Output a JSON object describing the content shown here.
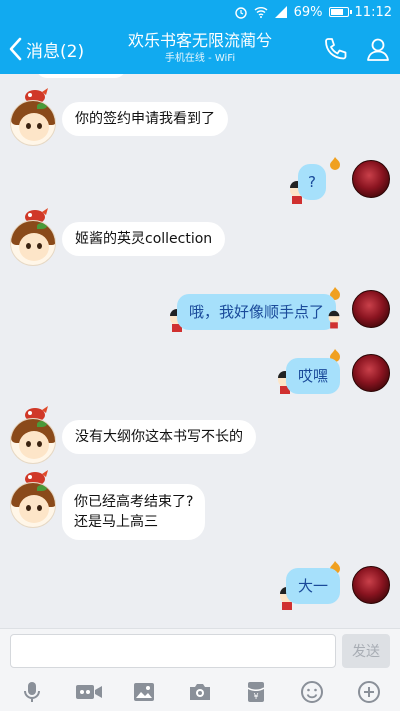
{
  "status_bar": {
    "battery": "69%",
    "time": "11:12",
    "battery_level": 0.69
  },
  "header": {
    "back_label": "消息(2)",
    "title": "欢乐书客无限流蔺兮",
    "subtitle": "手机在线 - WiFi"
  },
  "messages": [
    {
      "from": "them",
      "text": "你的签约申请我看到了"
    },
    {
      "from": "me",
      "text": "?"
    },
    {
      "from": "them",
      "text": "姬酱的英灵collection"
    },
    {
      "from": "me",
      "text": "哦，我好像顺手点了"
    },
    {
      "from": "me",
      "text": "哎嘿"
    },
    {
      "from": "them",
      "text": "没有大纲你这本书写不长的"
    },
    {
      "from": "them",
      "lines": [
        "你已经高考结束了?",
        "还是马上高三"
      ]
    },
    {
      "from": "me",
      "text": "大一"
    }
  ],
  "input": {
    "placeholder": "",
    "send_label": "发送"
  },
  "colors": {
    "accent": "#11aaf0",
    "bubble_out": "#a6e0fb",
    "bubble_in": "#ffffff",
    "background": "#eceef2"
  },
  "icons": [
    "mic-icon",
    "video-icon",
    "image-icon",
    "camera-icon",
    "red-packet-icon",
    "emoji-icon",
    "plus-icon"
  ]
}
